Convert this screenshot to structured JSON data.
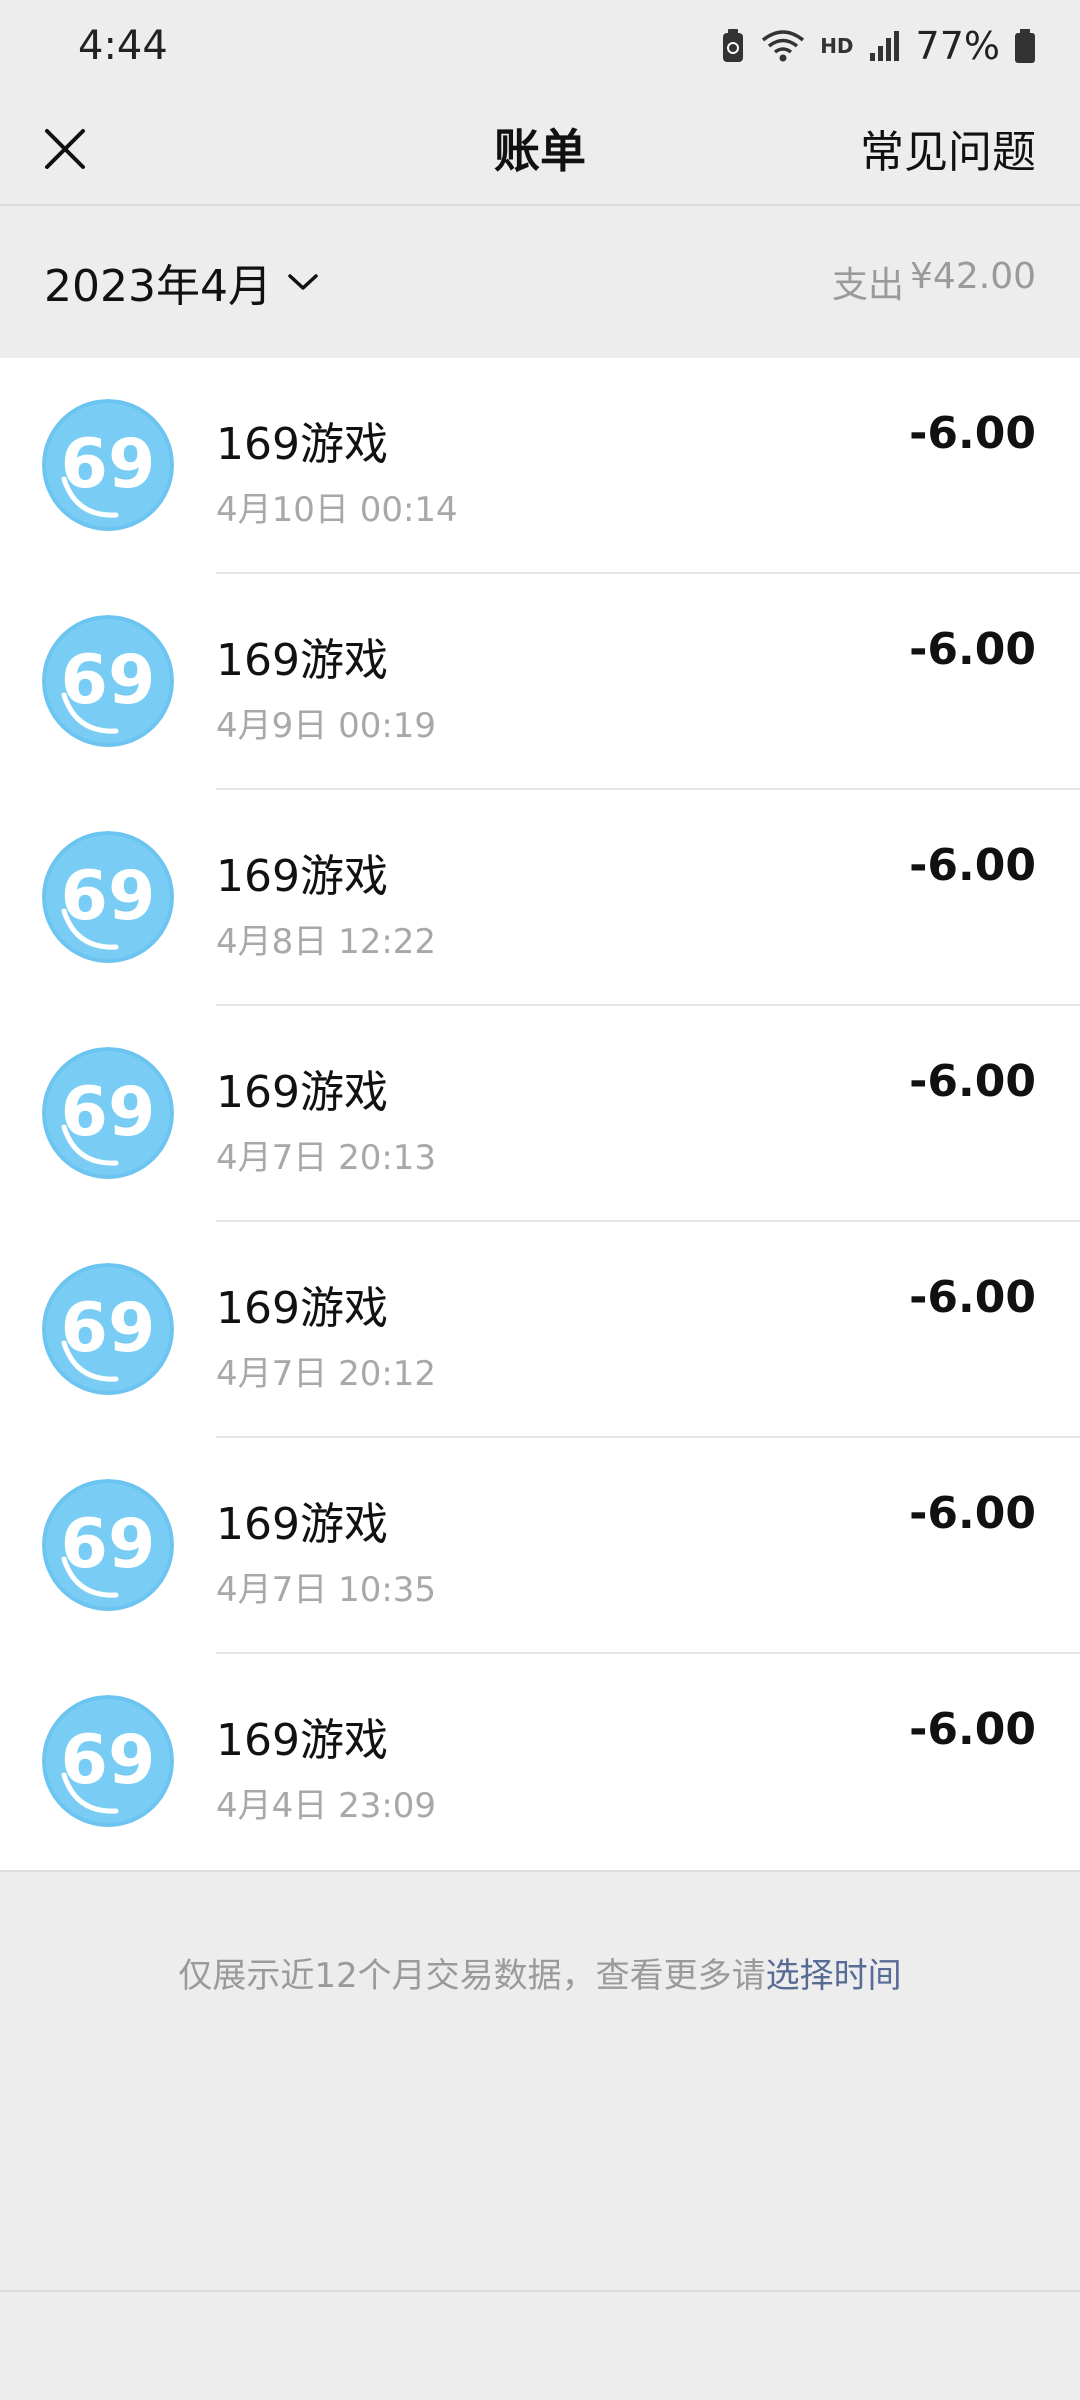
{
  "status_bar": {
    "time": "4:44",
    "net_label": "HD",
    "battery_pct": "77%"
  },
  "nav": {
    "title": "账单",
    "faq_label": "常见问题",
    "close_icon": "close-icon"
  },
  "summary": {
    "month": "2023年4月",
    "expense_label": "支出",
    "expense_amount": "¥42.00"
  },
  "transactions": [
    {
      "name": "169游戏",
      "time": "4月10日 00:14",
      "amount": "-6.00"
    },
    {
      "name": "169游戏",
      "time": "4月9日 00:19",
      "amount": "-6.00"
    },
    {
      "name": "169游戏",
      "time": "4月8日 12:22",
      "amount": "-6.00"
    },
    {
      "name": "169游戏",
      "time": "4月7日 20:13",
      "amount": "-6.00"
    },
    {
      "name": "169游戏",
      "time": "4月7日 20:12",
      "amount": "-6.00"
    },
    {
      "name": "169游戏",
      "time": "4月7日 10:35",
      "amount": "-6.00"
    },
    {
      "name": "169游戏",
      "time": "4月4日 23:09",
      "amount": "-6.00"
    }
  ],
  "footer": {
    "note_text": "仅展示近12个月交易数据，查看更多请",
    "link_text": "选择时间"
  },
  "colors": {
    "background": "#ededed",
    "link": "#576b95",
    "avatar": "#6cc4f0"
  }
}
